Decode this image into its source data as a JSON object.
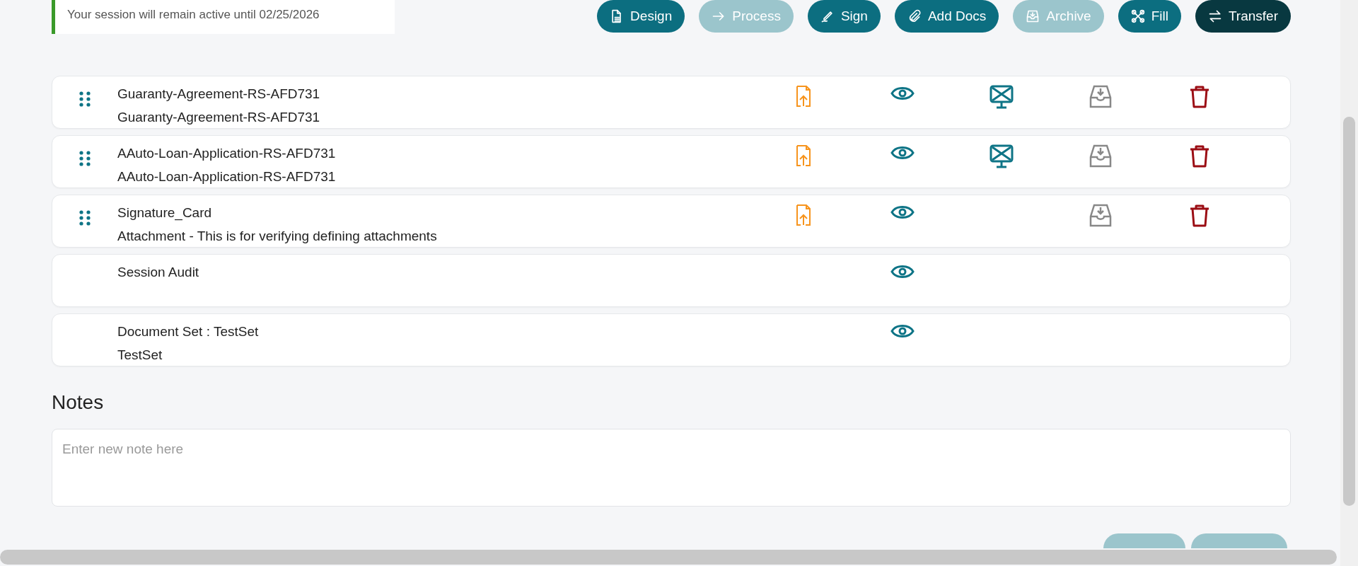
{
  "session_notice": "Your session will remain active until 02/25/2026",
  "toolbar": [
    {
      "label": "Design",
      "kind": "standard",
      "disabled": false
    },
    {
      "label": "Process",
      "kind": "standard",
      "disabled": true
    },
    {
      "label": "Sign",
      "kind": "standard",
      "disabled": false
    },
    {
      "label": "Add Docs",
      "kind": "standard",
      "disabled": false
    },
    {
      "label": "Archive",
      "kind": "standard",
      "disabled": true
    },
    {
      "label": "Fill",
      "kind": "standard",
      "disabled": false
    },
    {
      "label": "Transfer",
      "kind": "emphasis",
      "disabled": false
    }
  ],
  "documents": [
    {
      "title": "Guaranty-Agreement-RS-AFD731",
      "subtitle": "Guaranty-Agreement-RS-AFD731",
      "draggable": true,
      "actions": [
        {
          "kind": "upload"
        },
        {
          "kind": "view"
        },
        {
          "kind": "monitor"
        },
        {
          "kind": "archive"
        },
        {
          "kind": "delete"
        }
      ]
    },
    {
      "title": "AAuto-Loan-Application-RS-AFD731",
      "subtitle": "AAuto-Loan-Application-RS-AFD731",
      "draggable": true,
      "actions": [
        {
          "kind": "upload"
        },
        {
          "kind": "view"
        },
        {
          "kind": "monitor"
        },
        {
          "kind": "archive"
        },
        {
          "kind": "delete"
        }
      ]
    },
    {
      "title": "Signature_Card",
      "subtitle": "Attachment - This is for verifying defining attachments",
      "draggable": true,
      "actions": [
        {
          "kind": "upload"
        },
        {
          "kind": "view"
        },
        {
          "kind": "archive"
        },
        {
          "kind": "delete"
        }
      ]
    },
    {
      "title": "Session Audit",
      "draggable": false,
      "actions": [
        {
          "kind": "view"
        }
      ]
    },
    {
      "title": "Document Set : TestSet",
      "subtitle": "TestSet",
      "draggable": false,
      "actions": [
        {
          "kind": "view"
        }
      ]
    }
  ],
  "notes": {
    "heading": "Notes",
    "placeholder": "Enter new note here"
  },
  "footer_buttons": [
    {
      "disabled": true
    },
    {
      "disabled": true
    }
  ]
}
